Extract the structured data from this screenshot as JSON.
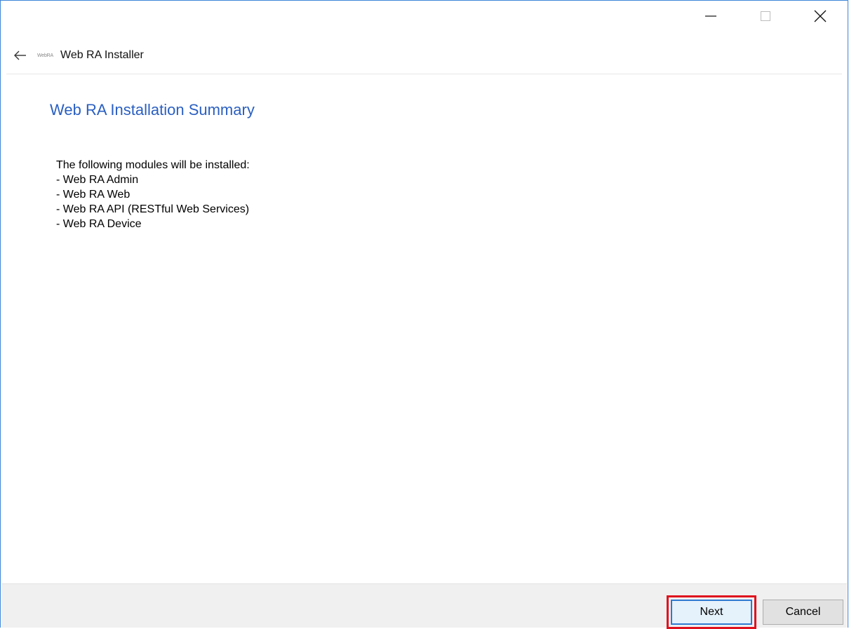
{
  "window": {
    "title": "Web RA  Installer",
    "logo_text": "WebRA"
  },
  "icons": {
    "minimize": "minimize-icon",
    "maximize": "maximize-icon",
    "close": "close-icon",
    "back": "back-arrow-icon"
  },
  "page": {
    "heading": "Web RA Installation Summary",
    "intro": "The following modules will be installed:",
    "modules": [
      "- Web RA Admin",
      "- Web RA Web",
      "- Web RA API (RESTful Web Services)",
      "- Web RA Device"
    ]
  },
  "footer": {
    "next_label": "Next",
    "cancel_label": "Cancel"
  },
  "colors": {
    "accent": "#2a5fc1",
    "highlight": "#e0101d",
    "window_border": "#3d86d8"
  }
}
